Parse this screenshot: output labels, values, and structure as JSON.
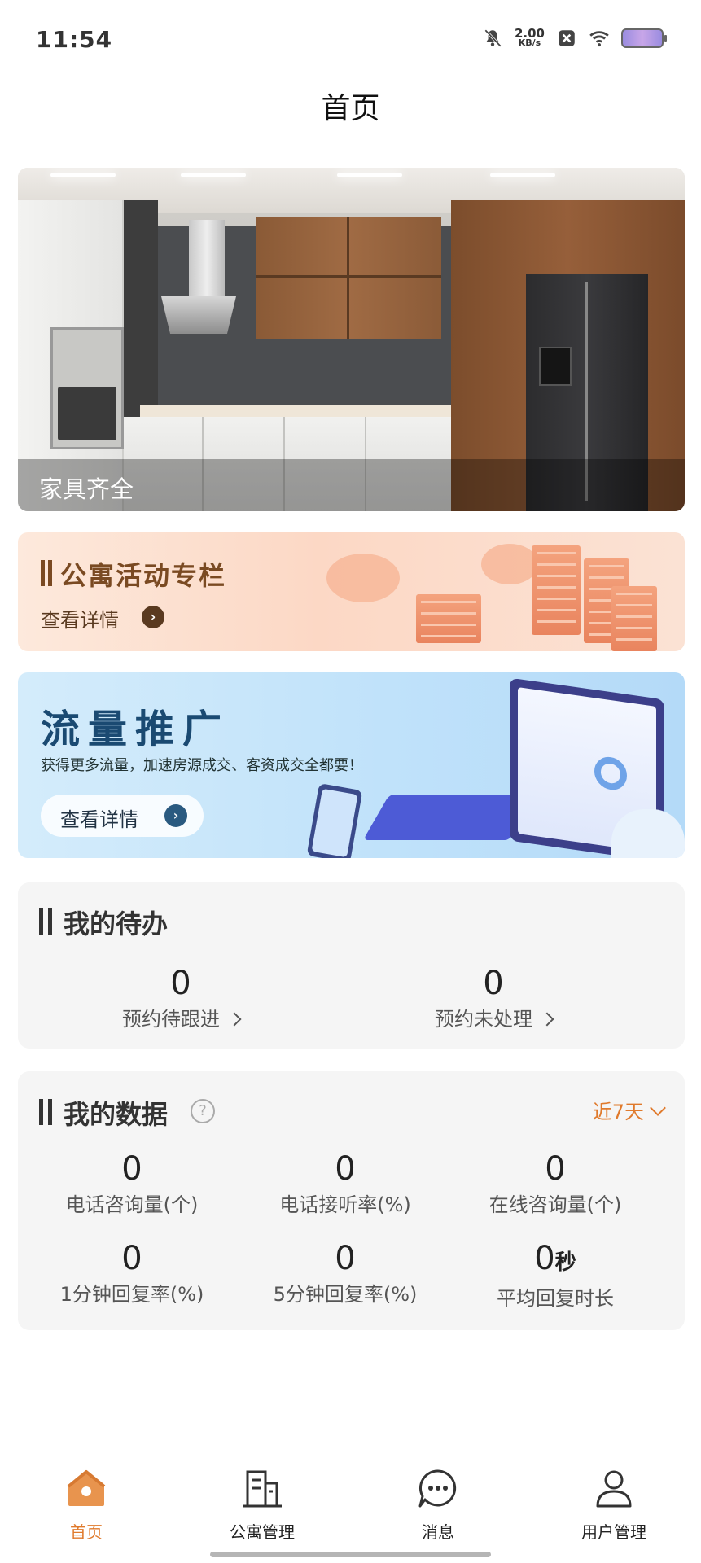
{
  "status_bar": {
    "time": "11:54",
    "net_speed_value": "2.00",
    "net_speed_unit": "KB/s",
    "icons": [
      "mute-bell-icon",
      "close-notification-icon",
      "wifi-icon",
      "battery-icon"
    ]
  },
  "header": {
    "title": "首页"
  },
  "banner": {
    "caption": "家具齐全"
  },
  "promo_activity": {
    "title": "公寓活动专栏",
    "link": "查看详情"
  },
  "promo_traffic": {
    "title": "流量推广",
    "subtitle": "获得更多流量，加速房源成交、客资成交全都要！",
    "button": "查看详情"
  },
  "todo": {
    "title": "我的待办",
    "items": [
      {
        "value": "0",
        "label": "预约待跟进"
      },
      {
        "value": "0",
        "label": "预约未处理"
      }
    ]
  },
  "my_data": {
    "title": "我的数据",
    "range": "近7天",
    "stats": [
      {
        "value": "0",
        "unit": "",
        "label": "电话咨询量(个)"
      },
      {
        "value": "0",
        "unit": "",
        "label": "电话接听率(%)"
      },
      {
        "value": "0",
        "unit": "",
        "label": "在线咨询量(个)"
      },
      {
        "value": "0",
        "unit": "",
        "label": "1分钟回复率(%)"
      },
      {
        "value": "0",
        "unit": "",
        "label": "5分钟回复率(%)"
      },
      {
        "value": "0",
        "unit": "秒",
        "label": "平均回复时长"
      }
    ]
  },
  "tabbar": {
    "active_color": "#e07a2c",
    "items": [
      {
        "label": "首页",
        "icon": "home-icon",
        "active": true
      },
      {
        "label": "公寓管理",
        "icon": "building-icon",
        "active": false
      },
      {
        "label": "消息",
        "icon": "message-icon",
        "active": false
      },
      {
        "label": "用户管理",
        "icon": "user-icon",
        "active": false
      }
    ]
  }
}
